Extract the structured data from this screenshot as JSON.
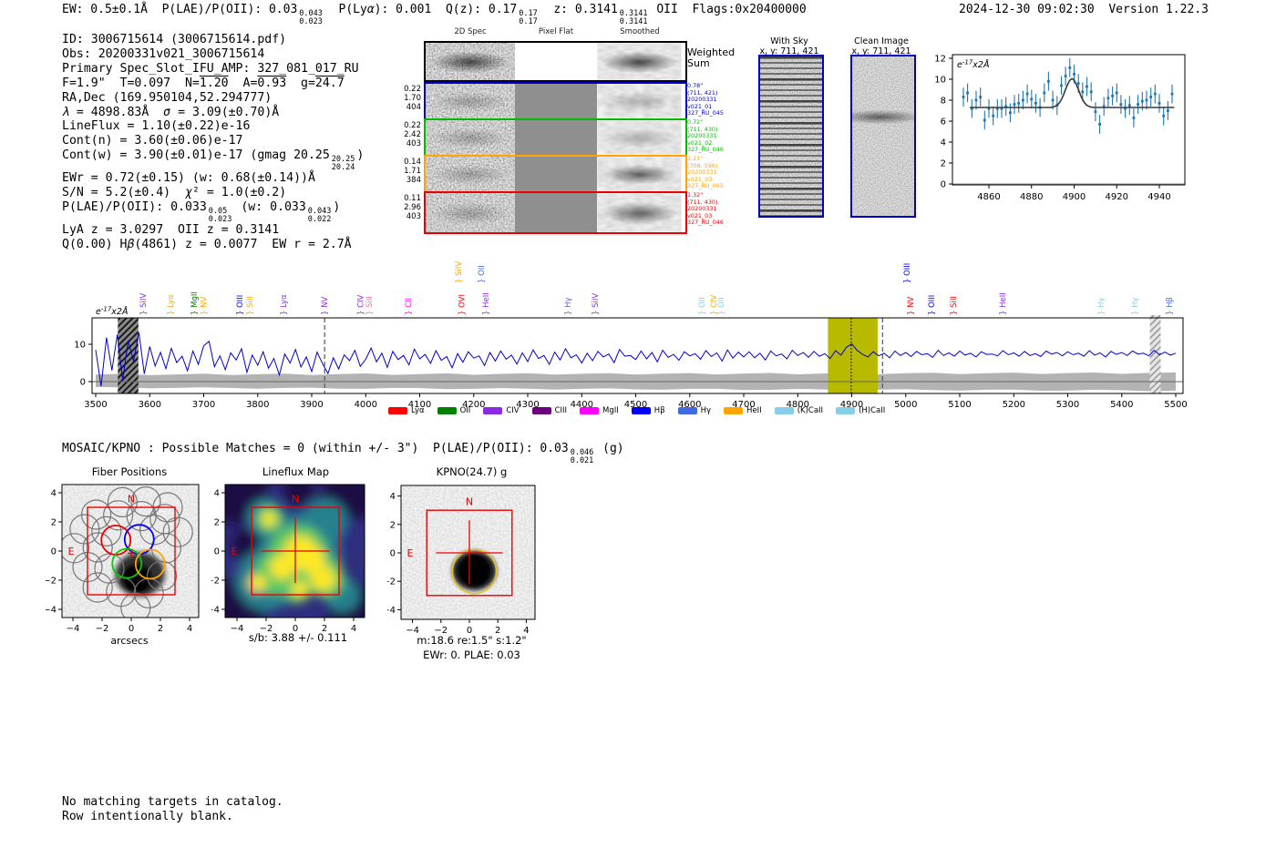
{
  "header": {
    "stats": [
      "EW: 0.5±0.1Å  P(LAE)/P(OII): 0.03",
      {
        "frac": [
          "0.043",
          "0.023"
        ]
      },
      "  P(Ly",
      {
        "i": "α"
      },
      "): 0.001  Q(z): 0.17",
      {
        "frac": [
          "0.17",
          "0.17"
        ]
      },
      "  z: 0.3141",
      {
        "frac": [
          "0.3141",
          "0.3141"
        ]
      },
      " OII  Flags:0x20400000"
    ],
    "timestamp": "2024-12-30 09:02:30  Version 1.22.3"
  },
  "info": {
    "lines": [
      [
        "ID: 3006715614 (3006715614.pdf)"
      ],
      [
        "Obs: 20200331v021_3006715614"
      ],
      [
        "Primary Spec_Slot_IFU_AMP: 327_081_017_RU"
      ],
      [
        "F=1.9\"  T=0.097  N=",
        {
          "ov": "1.20"
        },
        "  A=",
        {
          "ov": "0.93"
        },
        "  g=",
        {
          "ov": "24.7"
        }
      ],
      [
        "RA,Dec (169.950104,52.294777)"
      ],
      [
        {
          "i": "λ"
        },
        " = 4898.83Å  ",
        {
          "i": "σ"
        },
        " = 3.09(±0.70)Å"
      ],
      [
        "LineFlux = 1.10(±0.22)e-16"
      ],
      [
        "Cont(n) = 3.60(±0.06)e-17"
      ],
      [
        "Cont(w) = 3.90(±0.01)e-17 (gmag 20.25",
        {
          "frac": [
            "20.25",
            "20.24"
          ]
        },
        ")"
      ],
      [
        "EWr = 0.72(±0.15) (w: 0.68(±0.14))Å"
      ],
      [
        "S/N = 5.2(±0.4)  ",
        {
          "i": "χ"
        },
        "² = 1.0(±0.2)"
      ],
      [
        "P(LAE)/P(OII): 0.033",
        {
          "frac": [
            "0.05",
            "0.023"
          ]
        },
        " (w: 0.033",
        {
          "frac": [
            "0.043",
            "0.022"
          ]
        },
        ")"
      ],
      [
        "LyA z = 3.0297  OII z = 0.3141"
      ],
      [
        "Q(0.00) H",
        {
          "i": "β"
        },
        "(4861) z = 0.0077  EW r = 2.7Å"
      ]
    ]
  },
  "spec2d": {
    "col_headers": [
      "2D Spec",
      "Pixel Flat",
      "Smoothed"
    ],
    "weighted_label": [
      "Weighted",
      "Sum"
    ],
    "rows": [
      {
        "border": "#0000cc",
        "left": [
          "0.22",
          "1.70",
          "404"
        ],
        "right": [
          "0.78\"",
          "(711, 421)",
          "20200331",
          "v021_01",
          "327_RU_045"
        ]
      },
      {
        "border": "#00bb00",
        "left": [
          "0.22",
          "2.42",
          "403"
        ],
        "right": [
          "0.72\"",
          "(711, 430)",
          "20200331",
          "v021_02",
          "327_RU_046"
        ]
      },
      {
        "border": "#ffa500",
        "left": [
          "0.14",
          "1.71",
          "384"
        ],
        "right": [
          "1.21\"",
          "(708, 596)",
          "20200331",
          "v021_03",
          "327_RU_065"
        ]
      },
      {
        "border": "#ee0000",
        "left": [
          "0.11",
          "2.96",
          "403"
        ],
        "right": [
          "1.32\"",
          "(711, 430)",
          "20200331",
          "v021_03",
          "327_RU_046"
        ]
      }
    ]
  },
  "cutouts": {
    "with_sky": {
      "title": "With Sky",
      "coords": "x, y: 711, 421"
    },
    "clean": {
      "title": "Clean Image",
      "coords": "x, y: 711, 421"
    }
  },
  "chart_data": [
    {
      "id": "line_fit_zoom",
      "type": "scatter",
      "annotation": {
        "base": "e",
        "sup": "-17",
        "rest": "x2Å"
      },
      "xlim": [
        4843,
        4952
      ],
      "ylim": [
        -0.7,
        12.5
      ],
      "xticks": [
        4860,
        4880,
        4900,
        4920,
        4940
      ],
      "yticks": [
        0,
        2,
        4,
        6,
        8,
        10,
        12
      ],
      "x_start": 4848,
      "x_step": 2,
      "yerr": 0.9,
      "y": [
        8.3,
        8.7,
        7.2,
        8.0,
        8.3,
        6.1,
        7.2,
        6.5,
        7.2,
        7.2,
        7.4,
        6.8,
        7.6,
        7.7,
        8.0,
        8.6,
        8.1,
        7.7,
        7.3,
        8.7,
        9.8,
        8.0,
        7.5,
        9.4,
        10.3,
        11.1,
        10.5,
        9.6,
        8.8,
        9.3,
        8.8,
        6.9,
        5.7,
        7.4,
        8.2,
        8.4,
        8.7,
        7.6,
        7.2,
        7.5,
        6.3,
        7.6,
        7.9,
        8.0,
        8.3,
        8.6,
        7.7,
        6.5,
        7.0,
        8.6
      ],
      "fit": {
        "continuum": 7.3,
        "amplitude": 2.75,
        "center": 4899,
        "sigma": 3.1
      },
      "point_color": "#1f77b4",
      "fit_color": "#3a3a3a"
    },
    {
      "id": "full_spectrum",
      "type": "line",
      "annotation": {
        "base": "e",
        "sup": "-17",
        "rest": "x2Å"
      },
      "xlim": [
        3493,
        5513
      ],
      "ylim": [
        -3.3,
        17.3
      ],
      "xticks": [
        3500,
        3600,
        3700,
        3800,
        3900,
        4000,
        4100,
        4200,
        4300,
        4400,
        4500,
        4600,
        4700,
        4800,
        4900,
        5000,
        5100,
        5200,
        5300,
        5400,
        5500
      ],
      "yticks": [
        0,
        10
      ],
      "x_start": 3500,
      "x_step": 10,
      "flux": [
        8.5,
        -1.2,
        11.8,
        3.0,
        12.6,
        0.4,
        10.9,
        5.5,
        13.2,
        2.1,
        9.4,
        4.2,
        7.8,
        3.5,
        8.9,
        5.1,
        6.8,
        2.9,
        8.2,
        4.6,
        9.6,
        10.8,
        4.0,
        6.9,
        3.2,
        7.7,
        5.8,
        8.8,
        2.5,
        7.1,
        4.4,
        8.0,
        3.6,
        6.2,
        1.8,
        7.4,
        5.0,
        8.6,
        3.9,
        6.6,
        2.7,
        7.9,
        4.8,
        2.2,
        6.4,
        3.4,
        7.2,
        5.6,
        8.4,
        4.1,
        6.0,
        9.0,
        5.3,
        7.6,
        3.8,
        8.1,
        5.9,
        7.0,
        4.5,
        8.7,
        6.1,
        7.3,
        4.9,
        8.3,
        5.7,
        6.7,
        3.7,
        7.5,
        5.2,
        8.0,
        6.3,
        6.9,
        4.3,
        7.8,
        5.5,
        8.2,
        6.0,
        7.1,
        4.7,
        7.7,
        5.4,
        8.5,
        6.2,
        7.0,
        4.6,
        7.9,
        5.8,
        8.8,
        6.4,
        7.2,
        5.0,
        7.6,
        5.6,
        8.1,
        6.6,
        7.4,
        5.1,
        8.6,
        6.8,
        7.0,
        5.9,
        8.2,
        6.1,
        7.8,
        5.3,
        8.4,
        6.5,
        7.3,
        5.7,
        8.0,
        6.9,
        7.5,
        6.0,
        8.3,
        6.7,
        7.7,
        5.5,
        8.5,
        6.3,
        7.9,
        6.6,
        8.0,
        6.4,
        7.6,
        5.8,
        8.2,
        6.9,
        7.4,
        6.1,
        8.4,
        7.0,
        7.8,
        6.5,
        8.1,
        6.8,
        7.5,
        6.2,
        8.3,
        7.1,
        9.2,
        10.1,
        8.4,
        7.3,
        6.6,
        8.0,
        6.9,
        7.6,
        6.4,
        8.2,
        7.0,
        7.8,
        6.7,
        8.1,
        7.2,
        7.5,
        6.5,
        8.4,
        7.0,
        7.7,
        6.8,
        8.2,
        7.1,
        7.6,
        6.6,
        8.0,
        7.3,
        7.4,
        6.9,
        8.3,
        7.2,
        7.7,
        6.8,
        8.1,
        7.0,
        7.5,
        6.7,
        8.2,
        7.4,
        7.8,
        6.9,
        8.0,
        7.2,
        7.6,
        6.8,
        8.3,
        7.1,
        7.7,
        6.6,
        8.1,
        7.3,
        7.8,
        7.0,
        8.2,
        7.4,
        7.6,
        6.9,
        8.4,
        7.2,
        7.9,
        7.1,
        7.6
      ],
      "line_color": "#0000cd",
      "error_band": {
        "color": "#b3b3b3",
        "top_start": 1.9,
        "top_end": 2.3,
        "bottom_start": -1.6,
        "bottom_end": -2.4
      },
      "highlight_band": {
        "x0": 4856,
        "x1": 4948,
        "color": "#b8ba00"
      },
      "detected_line": 4899,
      "dashed_markers": [
        3924,
        4957
      ],
      "hatched_bands": [
        [
          3541,
          3579
        ],
        [
          5452,
          5472
        ]
      ],
      "line_labels": [
        {
          "name": "SiIV",
          "wl": 3588,
          "color": "#8a2be2",
          "tier": 0
        },
        {
          "name": "Lyα",
          "wl": 3638,
          "color": "#ffa500",
          "tier": 0
        },
        {
          "name": "MgII",
          "wl": 3682,
          "color": "#008000",
          "tier": 0
        },
        {
          "name": "NV",
          "wl": 3700,
          "color": "#ffa500",
          "tier": 0
        },
        {
          "name": "OIII",
          "wl": 3767,
          "color": "#0000ff",
          "tier": 0
        },
        {
          "name": "SiII",
          "wl": 3785,
          "color": "#ffa500",
          "tier": 0
        },
        {
          "name": "Lyα",
          "wl": 3848,
          "color": "#8a2be2",
          "tier": 0
        },
        {
          "name": "NV",
          "wl": 3924,
          "color": "#8a2be2",
          "tier": 0
        },
        {
          "name": "CIV",
          "wl": 3990,
          "color": "#8a2be2",
          "tier": 0
        },
        {
          "name": "SiII",
          "wl": 4006,
          "color": "#ff69b4",
          "tier": 0
        },
        {
          "name": "CII",
          "wl": 4079,
          "color": "#ff00ff",
          "tier": 0
        },
        {
          "name": "SiIV",
          "wl": 4172,
          "color": "#ffa500",
          "tier": 1
        },
        {
          "name": "OVI",
          "wl": 4178,
          "color": "#ff0000",
          "tier": 0
        },
        {
          "name": "OII",
          "wl": 4214,
          "color": "#4169e1",
          "tier": 1
        },
        {
          "name": "HeII",
          "wl": 4222,
          "color": "#8a2be2",
          "tier": 0
        },
        {
          "name": "Hγ",
          "wl": 4374,
          "color": "#6a5acd",
          "tier": 0
        },
        {
          "name": "SiIV",
          "wl": 4425,
          "color": "#8a2be2",
          "tier": 0
        },
        {
          "name": "OII",
          "wl": 4622,
          "color": "#87ceeb",
          "tier": 0
        },
        {
          "name": "CIV",
          "wl": 4644,
          "color": "#ffa500",
          "tier": 0
        },
        {
          "name": "OII",
          "wl": 4658,
          "color": "#87ceeb",
          "tier": 0
        },
        {
          "name": "OIII",
          "wl": 5002,
          "color": "#0000ff",
          "tier": 1
        },
        {
          "name": "NV",
          "wl": 5009,
          "color": "#ff0000",
          "tier": 0
        },
        {
          "name": "OIII",
          "wl": 5048,
          "color": "#0000ff",
          "tier": 0
        },
        {
          "name": "SiII",
          "wl": 5088,
          "color": "#ff0000",
          "tier": 0
        },
        {
          "name": "HeII",
          "wl": 5179,
          "color": "#8a2be2",
          "tier": 0
        },
        {
          "name": "Hγ",
          "wl": 5362,
          "color": "#87ceeb",
          "tier": 0
        },
        {
          "name": "Hγ",
          "wl": 5424,
          "color": "#87ceeb",
          "tier": 0
        },
        {
          "name": "Hβ",
          "wl": 5488,
          "color": "#4169e1",
          "tier": 0
        }
      ],
      "legend": [
        {
          "label": "Lyα",
          "color": "#ff0000"
        },
        {
          "label": "OII",
          "color": "#008000"
        },
        {
          "label": "CIV",
          "color": "#8a2be2"
        },
        {
          "label": "CIII",
          "color": "#6a0080"
        },
        {
          "label": "MgII",
          "color": "#ff00ff"
        },
        {
          "label": "Hβ",
          "color": "#0000ff"
        },
        {
          "label": "Hγ",
          "color": "#4169e1"
        },
        {
          "label": "HeII",
          "color": "#ffa500"
        },
        {
          "label": "(K)CaII",
          "color": "#87ceeb"
        },
        {
          "label": "(H)CaII",
          "color": "#87ceeb"
        }
      ]
    }
  ],
  "mosaic_line": [
    "MOSAIC/KPNO : Possible Matches = 0 (within +/- 3\")  P(LAE)/P(OII): 0.03",
    {
      "frac": [
        "0.046",
        "0.021"
      ]
    },
    " (g)"
  ],
  "panels": {
    "fiber": {
      "title": "Fiber Positions",
      "xlabel": "arcsecs",
      "xticks": [
        -4,
        -2,
        0,
        2,
        4
      ],
      "yticks": [
        -4,
        -2,
        0,
        2,
        4
      ],
      "north": "N",
      "east": "E",
      "box_color": "#ee0000",
      "fiber_colors": [
        "#ee0000",
        "#0000ff",
        "#00cc00",
        "#ffa500"
      ]
    },
    "lineflux": {
      "title": "Lineflux Map",
      "caption": "s/b: 3.88 +/- 0.111",
      "xticks": [
        -4,
        -2,
        0,
        2,
        4
      ],
      "yticks": [
        -4,
        -2,
        0,
        2,
        4
      ],
      "north": "N",
      "east": "E",
      "box_color": "#ee0000"
    },
    "kpno": {
      "title": "KPNO(24.7) g",
      "caption1": "m:18.6  re:1.5\"  s:1.2\"",
      "caption2": "EWr: 0. PLAE: 0.03",
      "xticks": [
        -4,
        -2,
        0,
        2,
        4
      ],
      "yticks": [
        -4,
        -2,
        0,
        2,
        4
      ],
      "north": "N",
      "east": "E",
      "box_color": "#ee0000",
      "aperture_color": "#e6c229"
    }
  },
  "footer": [
    "No matching targets in catalog.",
    "Row intentionally blank."
  ]
}
